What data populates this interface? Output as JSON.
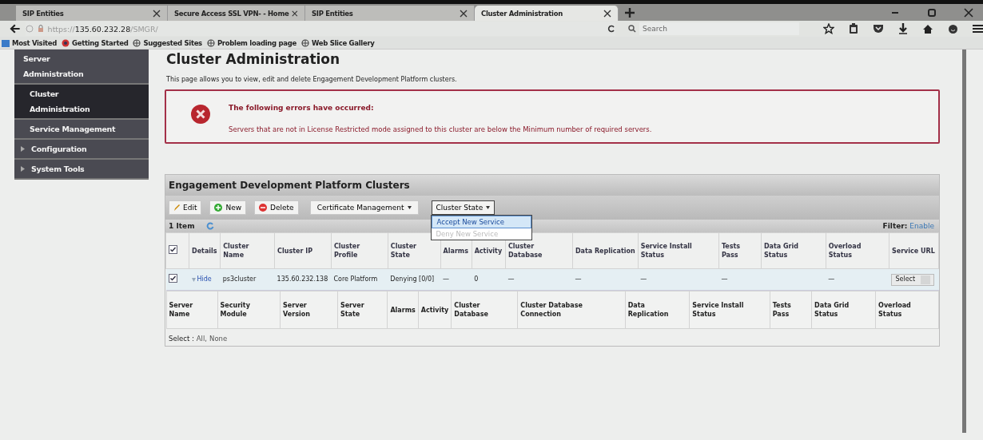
{
  "browser": {
    "tabs": [
      {
        "label": "SIP Entities",
        "selected": false
      },
      {
        "label": "Secure Access SSL VPN- - Home",
        "selected": false
      },
      {
        "label": "SIP Entities",
        "selected": false
      },
      {
        "label": "Cluster Administration",
        "selected": true
      }
    ],
    "url": {
      "scheme": "https://",
      "host": "135.60.232.28",
      "path": "/SMGR/"
    },
    "search": {
      "placeholder": "Search"
    },
    "bookmarks": [
      "Most Visited",
      "Getting Started",
      "Suggested Sites",
      "Problem loading page",
      "Web Slice Gallery"
    ]
  },
  "sidebar": {
    "items": [
      {
        "label": "Server Administration",
        "selected": false,
        "kind": "link"
      },
      {
        "label": "Cluster Administration",
        "selected": true,
        "kind": "link"
      },
      {
        "label": "Service Management",
        "selected": false,
        "kind": "link"
      },
      {
        "label": "Configuration",
        "selected": false,
        "kind": "group"
      },
      {
        "label": "System Tools",
        "selected": false,
        "kind": "group"
      }
    ]
  },
  "page": {
    "title": "Cluster Administration",
    "description": "This page allows you to view, edit and delete Engagement Development Platform clusters.",
    "error": {
      "title": "The following errors have occurred:",
      "message": "Servers that are not in License Restricted mode assigned to this cluster are below the Minimum number of required servers."
    }
  },
  "panel": {
    "title": "Engagement Development Platform Clusters",
    "toolbar": [
      {
        "label": "Edit",
        "kind": "edit"
      },
      {
        "label": "New",
        "kind": "new"
      },
      {
        "label": "Delete",
        "kind": "delete"
      },
      {
        "label": "Certificate Management",
        "kind": "menu"
      },
      {
        "label": "Cluster State",
        "kind": "menu"
      }
    ],
    "menu": [
      {
        "label": "Accept New Service",
        "selected": true,
        "disabled": false
      },
      {
        "label": "Deny New Service",
        "selected": false,
        "disabled": true
      }
    ],
    "count": "1 Item",
    "filter_label": "Filter:",
    "filter_link": "Enable",
    "columns": [
      "Details",
      "Cluster Name",
      "Cluster IP",
      "Cluster Profile",
      "Cluster State",
      "Alarms",
      "Activity",
      "Cluster Database",
      "Data Replication",
      "Service Install Status",
      "Tests Pass",
      "Data Grid Status",
      "Overload Status",
      "Service URL"
    ],
    "all_checked": true,
    "rows": [
      {
        "checked": true,
        "cells": [
          "Hide",
          "ps3cluster",
          "135.60.232.138",
          "Core Platform",
          "Denying [0/0]",
          "—",
          "0",
          "—",
          "—",
          "—",
          "—",
          null,
          "—",
          "Select"
        ]
      }
    ],
    "server_columns": [
      "Server Name",
      "Security Module",
      "Server Version",
      "Server State",
      "Alarms",
      "Activity",
      "Cluster Database",
      "Cluster Database Connection",
      "Data Replication",
      "Service Install Status",
      "Tests Pass",
      "Data Grid Status",
      "Overload Status"
    ],
    "select_label": "Select :",
    "select_links": [
      "All,",
      "None"
    ]
  }
}
